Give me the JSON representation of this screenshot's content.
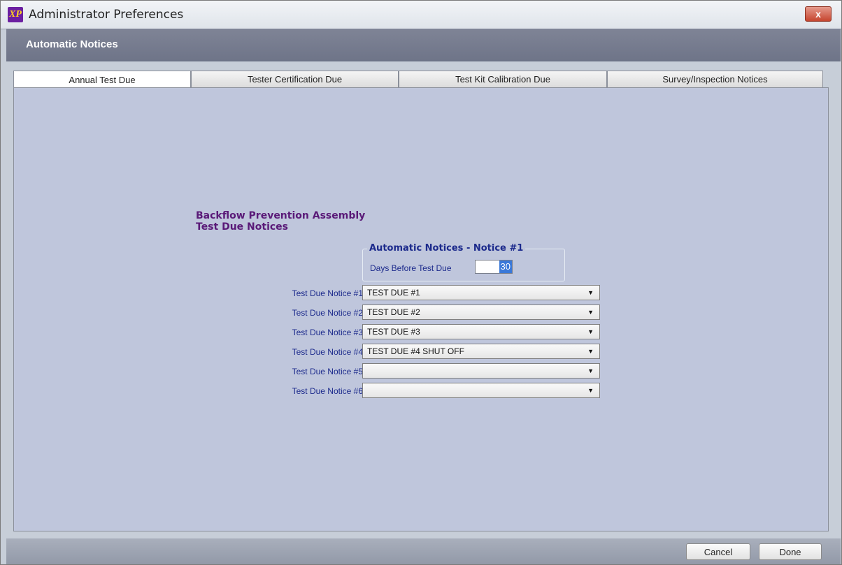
{
  "window": {
    "title": "Administrator Preferences",
    "close_label": "x",
    "app_icon_glyph": "XP"
  },
  "header": {
    "title": "Automatic Notices"
  },
  "tabs": [
    {
      "label": "Annual Test Due",
      "active": true
    },
    {
      "label": "Tester Certification Due",
      "active": false
    },
    {
      "label": "Test Kit Calibration Due",
      "active": false
    },
    {
      "label": "Survey/Inspection Notices",
      "active": false
    }
  ],
  "section": {
    "heading_line1": "Backflow Prevention Assembly",
    "heading_line2": "Test Due Notices"
  },
  "group": {
    "legend": "Automatic Notices - Notice #1",
    "days_label": "Days Before Test Due",
    "days_value": "30"
  },
  "notices": [
    {
      "label": "Test Due Notice #1",
      "value": "TEST DUE #1"
    },
    {
      "label": "Test Due Notice #2",
      "value": "TEST DUE #2"
    },
    {
      "label": "Test Due Notice #3",
      "value": "TEST DUE #3"
    },
    {
      "label": "Test Due Notice #4",
      "value": "TEST DUE #4 SHUT OFF"
    },
    {
      "label": "Test Due Notice #5",
      "value": ""
    },
    {
      "label": "Test Due Notice #6",
      "value": ""
    }
  ],
  "footer": {
    "cancel_label": "Cancel",
    "done_label": "Done"
  },
  "colors": {
    "accent": "#1c2a8c",
    "heading": "#5a1a78",
    "header_band": "#74798c",
    "panel_bg": "#bfc6dc"
  }
}
